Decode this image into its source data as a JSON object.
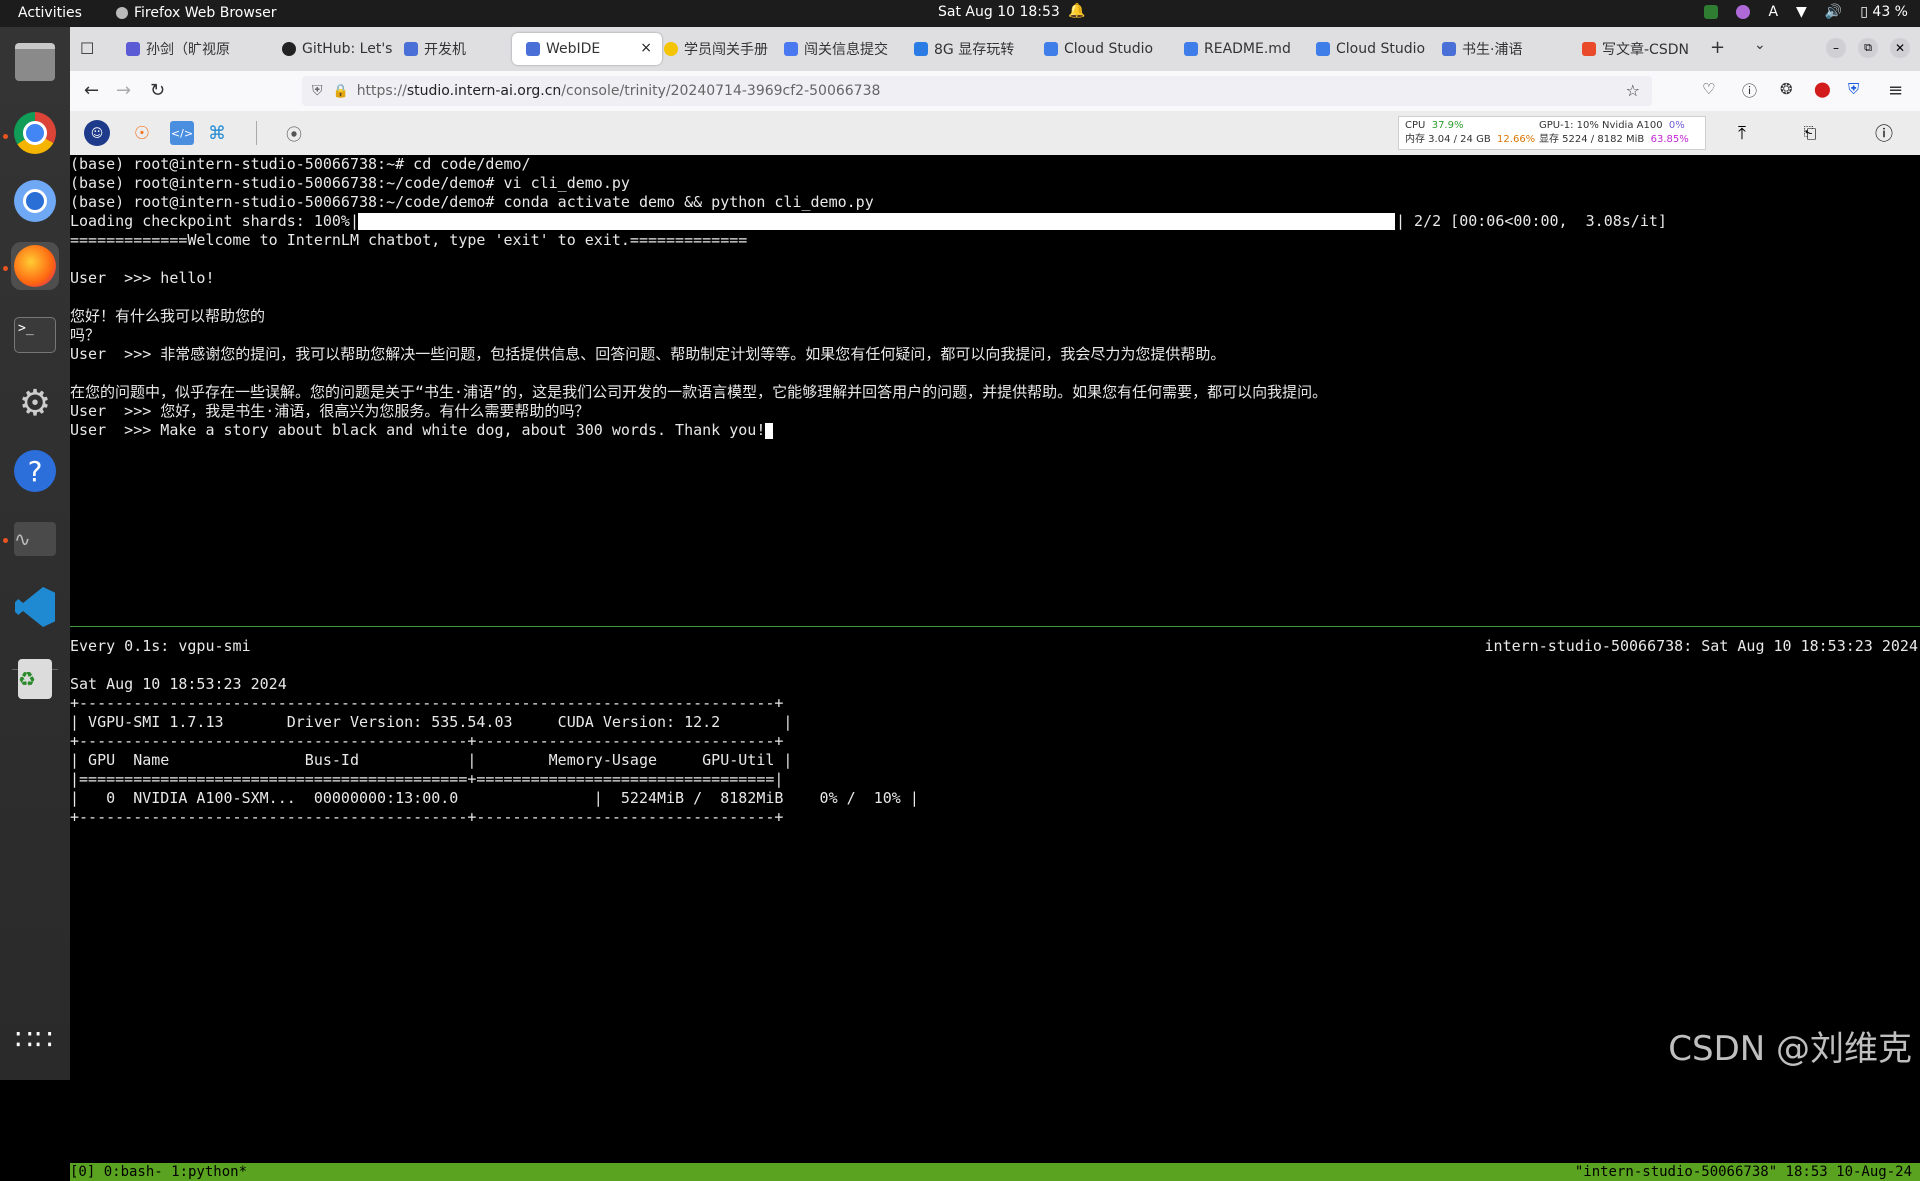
{
  "topbar": {
    "activities": "Activities",
    "app_name": "Firefox Web Browser",
    "clock": "Sat Aug 10  18:53",
    "input_method": "A",
    "battery": "43 %"
  },
  "dock": {
    "items": [
      "files-icon",
      "chrome-icon",
      "chromium-icon",
      "firefox-icon",
      "terminal-icon",
      "settings-icon",
      "help-icon",
      "system-monitor-icon",
      "vscode-icon",
      "trash-icon",
      "app-grid-icon"
    ]
  },
  "browser": {
    "tabs": [
      {
        "label": "孙剑（旷视原",
        "icon_color": "#5b5bd6"
      },
      {
        "label": "GitHub: Let's",
        "icon_color": "#222222"
      },
      {
        "label": "开发机",
        "icon_color": "#4a6fd6"
      },
      {
        "label": "WebIDE",
        "icon_color": "#4a6fd6",
        "active": true,
        "close": "×"
      },
      {
        "label": "学员闯关手册",
        "icon_color": "#f5c400"
      },
      {
        "label": "闯关信息提交",
        "icon_color": "#4a78f0"
      },
      {
        "label": "8G 显存玩转",
        "icon_color": "#2a7be4"
      },
      {
        "label": "Cloud Studio",
        "icon_color": "#3f7de8"
      },
      {
        "label": "README.md",
        "icon_color": "#3f7de8"
      },
      {
        "label": "Cloud Studio",
        "icon_color": "#3f7de8"
      },
      {
        "label": "书生·浦语",
        "icon_color": "#4a6fd6"
      },
      {
        "label": "写文章-CSDN",
        "icon_color": "#e84a2a"
      }
    ],
    "url_prefix": "https://",
    "url_host": "studio.intern-ai.org.cn",
    "url_path": "/console/trinity/20240714-3969cf2-50066738"
  },
  "ide_stats": {
    "cpu_label": "CPU",
    "cpu_value": "37.9%",
    "mem_label": "内存 3.04 / 24 GB",
    "mem_value": "12.66%",
    "gpu_label": "GPU-1: 10% Nvidia A100",
    "gpu_value": "0%",
    "vram_label": "显存 5224 / 8182 MiB",
    "vram_value": "63.85%"
  },
  "terminal": {
    "top_lines": [
      "(base) root@intern-studio-50066738:~# cd code/demo/",
      "(base) root@intern-studio-50066738:~/code/demo# vi cli_demo.py",
      "(base) root@intern-studio-50066738:~/code/demo# conda activate demo && python cli_demo.py"
    ],
    "loading_left": "Loading checkpoint shards: 100%|",
    "loading_right": "| 2/2 [00:06<00:00,  3.08s/it]",
    "welcome": "=============Welcome to InternLM chatbot, type 'exit' to exit.=============",
    "chat_lines": [
      "User  >>> hello!",
      "",
      "您好！有什么我可以帮助您的",
      "吗？",
      "User  >>> 非常感谢您的提问，我可以帮助您解决一些问题，包括提供信息、回答问题、帮助制定计划等等。如果您有任何疑问，都可以向我提问，我会尽力为您提供帮助。",
      "",
      "在您的问题中，似乎存在一些误解。您的问题是关于“书生·浦语”的，这是我们公司开发的一款语言模型，它能够理解并回答用户的问题，并提供帮助。如果您有任何需要，都可以向我提问。",
      "User  >>> 您好，我是书生·浦语，很高兴为您服务。有什么需要帮助的吗？",
      "User  >>> Make a story about black and white dog, about 300 words. Thank you!"
    ],
    "watch_header_left": "Every 0.1s: vgpu-smi",
    "watch_header_right": "intern-studio-50066738: Sat Aug 10 18:53:23 2024",
    "smi_lines": [
      "Sat Aug 10 18:53:23 2024",
      "+-----------------------------------------------------------------------------+",
      "| VGPU-SMI 1.7.13       Driver Version: 535.54.03     CUDA Version: 12.2       |",
      "+-------------------------------------------+---------------------------------+",
      "| GPU  Name               Bus-Id            |        Memory-Usage     GPU-Util |",
      "|===========================================+=================================|",
      "|   0  NVIDIA A100-SXM...  00000000:13:00.0               |  5224MiB /  8182MiB    0% /  10% |",
      "+-------------------------------------------+---------------------------------+"
    ],
    "status_left": "[0] 0:bash- 1:python*",
    "status_right": "\"intern-studio-50066738\" 18:53 10-Aug-24"
  },
  "watermark": "CSDN @刘维克"
}
